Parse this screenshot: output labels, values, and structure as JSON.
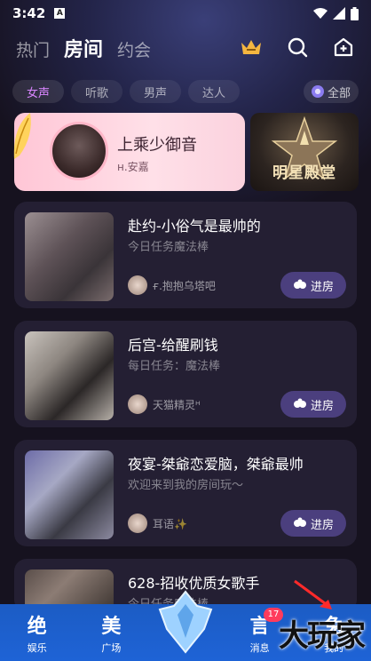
{
  "status": {
    "time": "3:42"
  },
  "nav": {
    "tabs": [
      "热门",
      "房间",
      "约会"
    ]
  },
  "subtabs": {
    "items": [
      "女声",
      "听歌",
      "男声",
      "达人"
    ],
    "all_label": "全部"
  },
  "feature": {
    "title": "上乘少御音",
    "host": "н.安嘉"
  },
  "star_hall": {
    "label": "明星殿堂"
  },
  "rooms": [
    {
      "title": "赴约-小俗气是最帅的",
      "desc": "今日任务魔法棒",
      "host": "ғ.抱抱乌塔吧",
      "enter": "进房"
    },
    {
      "title": "后宫-给醒刷钱",
      "desc": "每日任务：魔法棒",
      "host": "天猫精灵ᴴ",
      "enter": "进房"
    },
    {
      "title": "夜宴-桀爺恋爱脑，桀爺最帅",
      "desc": "欢迎来到我的房间玩～",
      "host": "耳语✨",
      "enter": "进房"
    },
    {
      "title": "628-招收优质女歌手",
      "desc": "今日任务魔法棒",
      "host": "",
      "enter": ""
    }
  ],
  "bottom_nav": {
    "items": [
      {
        "icon_text": "绝",
        "label": "娱乐"
      },
      {
        "icon_text": "美",
        "label": "广场"
      },
      {
        "icon_text": "",
        "label": ""
      },
      {
        "icon_text": "言",
        "label": "消息"
      },
      {
        "icon_text": "兔",
        "label": "我的"
      }
    ],
    "message_badge": "17"
  },
  "watermark": "大玩家",
  "colors": {
    "accent": "#d986ff",
    "bottom_bar": "#1e63d6",
    "enter_button": "#4b3f7e",
    "badge": "#ff3b5c"
  }
}
